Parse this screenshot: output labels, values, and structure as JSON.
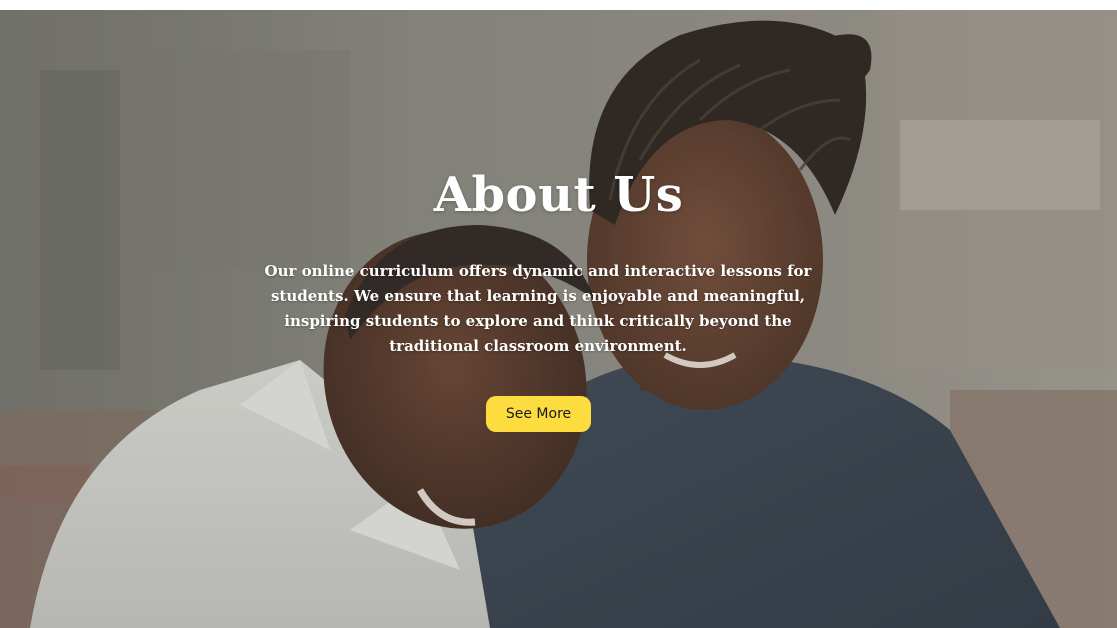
{
  "hero": {
    "title": "About Us",
    "description": "Our online curriculum offers dynamic and interactive lessons for students. We ensure that learning is enjoyable and meaningful, inspiring students to explore and think critically beyond the traditional classroom environment.",
    "cta_label": "See More",
    "cta_color": "#fcdc3e",
    "background_image": "photo of a smiling woman with braided hair and a smiling boy in a white shirt"
  }
}
